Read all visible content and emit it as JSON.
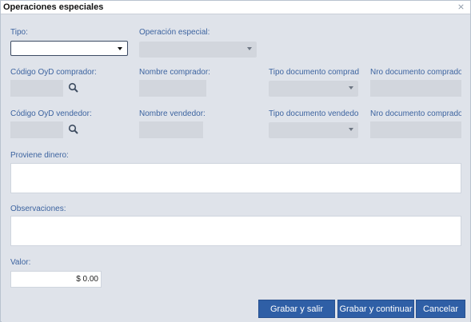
{
  "window": {
    "title": "Operaciones especiales",
    "close_glyph": "⨯"
  },
  "fields": {
    "tipo": {
      "label": "Tipo:",
      "value": ""
    },
    "operacion_especial": {
      "label": "Operación especial:",
      "value": ""
    },
    "codigo_comprador": {
      "label": "Código OyD comprador:"
    },
    "nombre_comprador": {
      "label": "Nombre comprador:"
    },
    "tipo_doc_comprador": {
      "label": "Tipo documento comprad"
    },
    "nro_doc_comprador": {
      "label": "Nro documento comprador"
    },
    "codigo_vendedor": {
      "label": "Código OyD vendedor:"
    },
    "nombre_vendedor": {
      "label": "Nombre vendedor:"
    },
    "tipo_doc_vendedor": {
      "label": "Tipo documento vendedo"
    },
    "nro_doc_vendedor": {
      "label": "Nro documento comprador"
    },
    "proviene_dinero": {
      "label": "Proviene dinero:",
      "value": ""
    },
    "observaciones": {
      "label": "Observaciones:",
      "value": ""
    },
    "valor": {
      "label": "Valor:",
      "value": "$ 0.00"
    }
  },
  "buttons": {
    "grabar_salir": "Grabar y salir",
    "grabar_continuar": "Grabar y continuar",
    "cancelar": "Cancelar"
  },
  "colors": {
    "button_blue": "#2f5fa6",
    "label_blue": "#3d64a0",
    "panel_bg": "#dfe3ea"
  },
  "icons": {
    "search": "magnifier-icon",
    "dropdown": "chevron-down-icon"
  }
}
